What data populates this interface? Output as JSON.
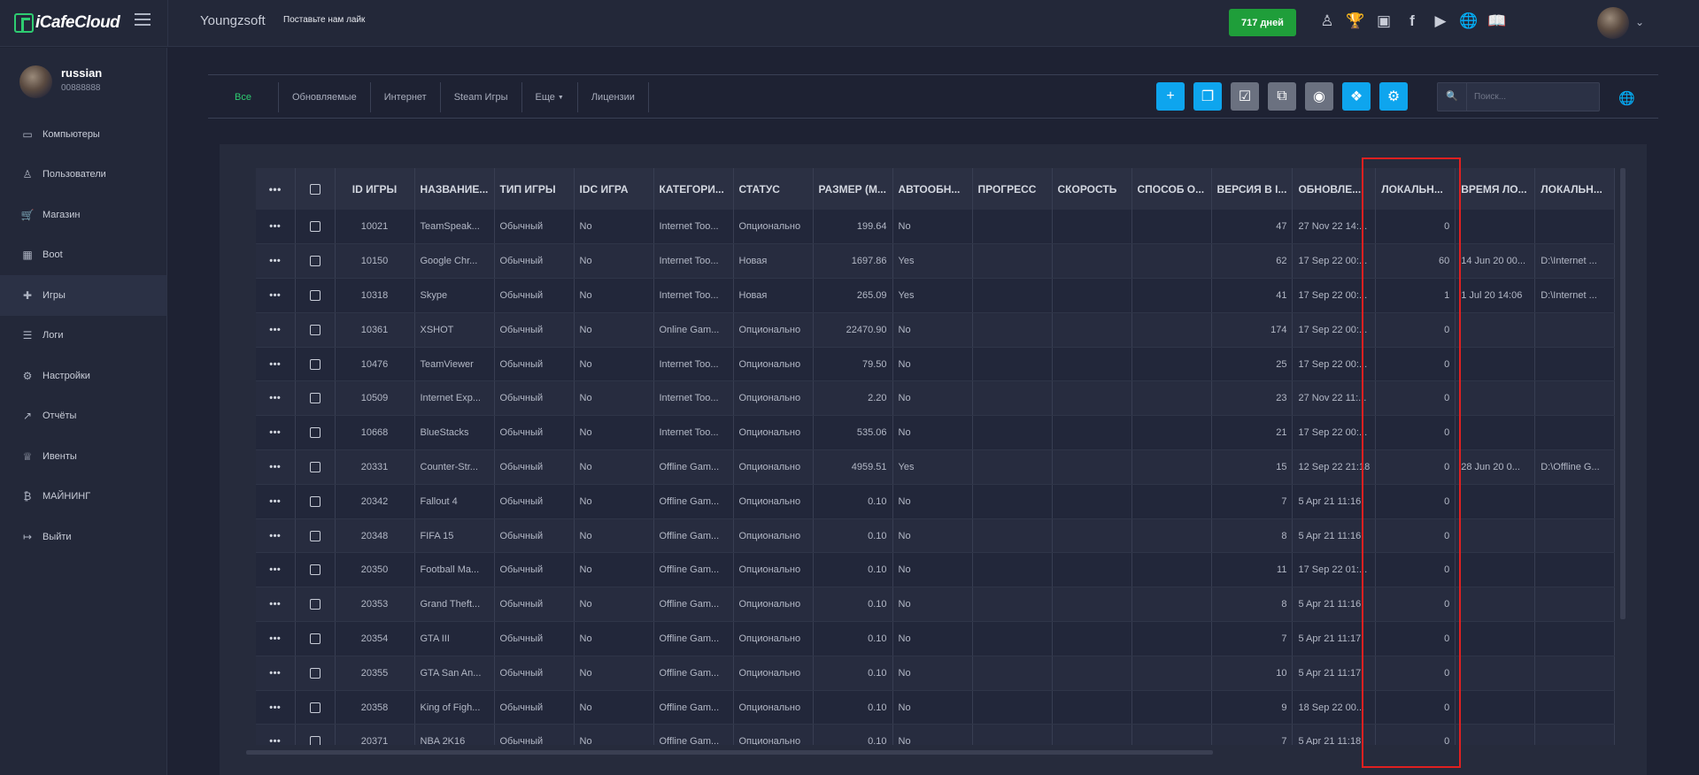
{
  "app": {
    "logo_text": "iCafeCloud",
    "cafe_name": "Youngzsoft",
    "like_text": "Поставьте нам лайк",
    "days_label": "717 дней",
    "top_icons": [
      "users-icon",
      "trophy-icon",
      "discord-icon",
      "facebook-icon",
      "youtube-icon",
      "globe-icon",
      "book-icon"
    ]
  },
  "user": {
    "name": "russian",
    "id": "00888888"
  },
  "sidebar": {
    "items": [
      {
        "label": "Компьютеры",
        "icon": "monitor-icon"
      },
      {
        "label": "Пользователи",
        "icon": "users-icon"
      },
      {
        "label": "Магазин",
        "icon": "cart-icon"
      },
      {
        "label": "Boot",
        "icon": "windows-icon"
      },
      {
        "label": "Игры",
        "icon": "gamepad-icon",
        "active": true
      },
      {
        "label": "Логи",
        "icon": "list-icon"
      },
      {
        "label": "Настройки",
        "icon": "gear-icon"
      },
      {
        "label": "Отчёты",
        "icon": "chart-icon"
      },
      {
        "label": "Ивенты",
        "icon": "crown-icon"
      },
      {
        "label": "МАЙНИНГ",
        "icon": "bitcoin-icon"
      },
      {
        "label": "Выйти",
        "icon": "logout-icon"
      }
    ]
  },
  "filters": {
    "tabs": [
      "Все",
      "Обновляемые",
      "Интернет",
      "Steam Игры",
      "Еще",
      "Лицензии"
    ],
    "active": "Все",
    "search_placeholder": "Поиск..."
  },
  "table": {
    "headers": [
      "",
      "",
      "ID ИГРЫ",
      "НАЗВАНИЕ...",
      "ТИП ИГРЫ",
      "IDC ИГРА",
      "КАТЕГОРИ...",
      "СТАТУС",
      "РАЗМЕР (М...",
      "АВТООБН...",
      "ПРОГРЕСС",
      "СКОРОСТЬ",
      "СПОСОБ О...",
      "ВЕРСИЯ В I...",
      "ОБНОВЛЕ...",
      "ЛОКАЛЬН...",
      "ВРЕМЯ ЛО...",
      "ЛОКАЛЬН..."
    ],
    "rows": [
      [
        "10021",
        "TeamSpeak...",
        "Обычный",
        "No",
        "Internet Too...",
        "Опционально",
        "199.64",
        "No",
        "",
        "",
        "",
        "47",
        "27 Nov 22 14:...",
        "0",
        "",
        ""
      ],
      [
        "10150",
        "Google Chr...",
        "Обычный",
        "No",
        "Internet Too...",
        "Новая",
        "1697.86",
        "Yes",
        "",
        "",
        "",
        "62",
        "17 Sep 22 00:...",
        "60",
        "14 Jun 20 00...",
        "D:\\Internet ..."
      ],
      [
        "10318",
        "Skype",
        "Обычный",
        "No",
        "Internet Too...",
        "Новая",
        "265.09",
        "Yes",
        "",
        "",
        "",
        "41",
        "17 Sep 22 00:...",
        "1",
        "1 Jul 20 14:06",
        "D:\\Internet ..."
      ],
      [
        "10361",
        "XSHOT",
        "Обычный",
        "No",
        "Online Gam...",
        "Опционально",
        "22470.90",
        "No",
        "",
        "",
        "",
        "174",
        "17 Sep 22 00:...",
        "0",
        "",
        ""
      ],
      [
        "10476",
        "TeamViewer",
        "Обычный",
        "No",
        "Internet Too...",
        "Опционально",
        "79.50",
        "No",
        "",
        "",
        "",
        "25",
        "17 Sep 22 00:...",
        "0",
        "",
        ""
      ],
      [
        "10509",
        "Internet Exp...",
        "Обычный",
        "No",
        "Internet Too...",
        "Опционально",
        "2.20",
        "No",
        "",
        "",
        "",
        "23",
        "27 Nov 22 11:...",
        "0",
        "",
        ""
      ],
      [
        "10668",
        "BlueStacks",
        "Обычный",
        "No",
        "Internet Too...",
        "Опционально",
        "535.06",
        "No",
        "",
        "",
        "",
        "21",
        "17 Sep 22 00:...",
        "0",
        "",
        ""
      ],
      [
        "20331",
        "Counter-Str...",
        "Обычный",
        "No",
        "Offline Gam...",
        "Опционально",
        "4959.51",
        "Yes",
        "",
        "",
        "",
        "15",
        "12 Sep 22 21:18",
        "0",
        "28 Jun 20 0...",
        "D:\\Offline G..."
      ],
      [
        "20342",
        "Fallout 4",
        "Обычный",
        "No",
        "Offline Gam...",
        "Опционально",
        "0.10",
        "No",
        "",
        "",
        "",
        "7",
        "5 Apr 21 11:16",
        "0",
        "",
        ""
      ],
      [
        "20348",
        "FIFA 15",
        "Обычный",
        "No",
        "Offline Gam...",
        "Опционально",
        "0.10",
        "No",
        "",
        "",
        "",
        "8",
        "5 Apr 21 11:16",
        "0",
        "",
        ""
      ],
      [
        "20350",
        "Football Ma...",
        "Обычный",
        "No",
        "Offline Gam...",
        "Опционально",
        "0.10",
        "No",
        "",
        "",
        "",
        "11",
        "17 Sep 22 01:...",
        "0",
        "",
        ""
      ],
      [
        "20353",
        "Grand Theft...",
        "Обычный",
        "No",
        "Offline Gam...",
        "Опционально",
        "0.10",
        "No",
        "",
        "",
        "",
        "8",
        "5 Apr 21 11:16",
        "0",
        "",
        ""
      ],
      [
        "20354",
        "GTA III",
        "Обычный",
        "No",
        "Offline Gam...",
        "Опционально",
        "0.10",
        "No",
        "",
        "",
        "",
        "7",
        "5 Apr 21 11:17",
        "0",
        "",
        ""
      ],
      [
        "20355",
        "GTA San An...",
        "Обычный",
        "No",
        "Offline Gam...",
        "Опционально",
        "0.10",
        "No",
        "",
        "",
        "",
        "10",
        "5 Apr 21 11:17",
        "0",
        "",
        ""
      ],
      [
        "20358",
        "King of Figh...",
        "Обычный",
        "No",
        "Offline Gam...",
        "Опционально",
        "0.10",
        "No",
        "",
        "",
        "",
        "9",
        "18 Sep 22 00...",
        "0",
        "",
        ""
      ],
      [
        "20371",
        "NBA 2K16",
        "Обычный",
        "No",
        "Offline Gam...",
        "Опционально",
        "0.10",
        "No",
        "",
        "",
        "",
        "7",
        "5 Apr 21 11:18",
        "0",
        "",
        ""
      ]
    ]
  },
  "colors": {
    "accent_green": "#2ecc71",
    "button_blue": "#0ea5ee",
    "button_gray": "#6b7180",
    "days_green": "#1f9e3a",
    "highlight_red": "#e02020"
  }
}
